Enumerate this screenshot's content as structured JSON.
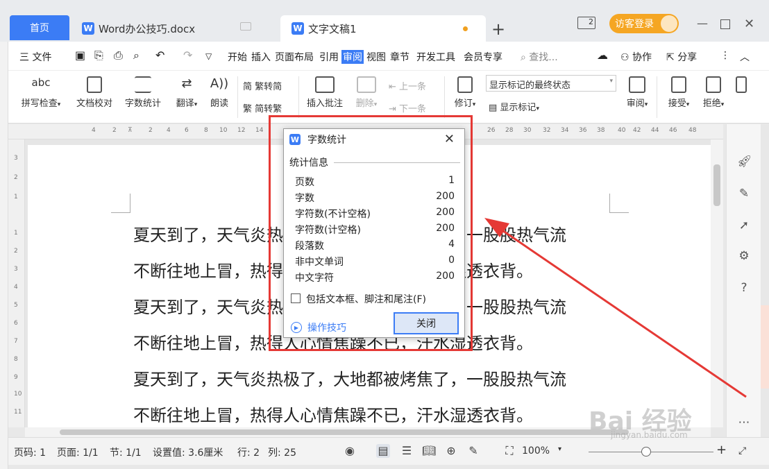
{
  "tabs": {
    "home": "首页",
    "doc1": "Word办公技巧.docx",
    "doc2": "文字文稿1",
    "doc_icon": "W"
  },
  "header": {
    "login": "访客登录"
  },
  "menu": {
    "file": "三 文件",
    "items": [
      "开始",
      "插入",
      "页面布局",
      "引用",
      "审阅",
      "视图",
      "章节",
      "开发工具",
      "会员专享"
    ],
    "search": "查找...",
    "collab": "协作",
    "share": "分享"
  },
  "ribbon": {
    "spell": "拼写检查",
    "proof": "文档校对",
    "wordcount": "字数统计",
    "translate": "翻译",
    "read": "朗读",
    "trad": "繁转简",
    "simp": "简转繁",
    "insert_comment": "插入批注",
    "delete": "删除",
    "prev": "上一条",
    "next": "下一条",
    "track": "修订",
    "show_state": "显示标记的最终状态",
    "show_marks": "显示标记",
    "review": "审阅",
    "accept": "接受",
    "reject": "拒绝"
  },
  "document": {
    "lines": [
      "夏天到了，天气炎热极了，大地都被烤焦了，一股股热气流",
      "不断往地上冒，热得人心情焦躁不已，汗水湿透衣背。",
      "夏天到了，天气炎热极了，大地都被烤焦了，一股股热气流",
      "不断往地上冒，热得人心情焦躁不已，汗水湿透衣背。",
      "夏天到了，天气炎热极了，大地都被烤焦了，一股股热气流",
      "不断往地上冒，热得人心情焦躁不已，汗水湿透衣背。"
    ]
  },
  "dialog": {
    "title": "字数统计",
    "section": "统计信息",
    "stats": [
      {
        "label": "页数",
        "value": "1"
      },
      {
        "label": "字数",
        "value": "200"
      },
      {
        "label": "字符数(不计空格)",
        "value": "200"
      },
      {
        "label": "字符数(计空格)",
        "value": "200"
      },
      {
        "label": "段落数",
        "value": "4"
      },
      {
        "label": "非中文单词",
        "value": "0"
      },
      {
        "label": "中文字符",
        "value": "200"
      }
    ],
    "checkbox_label": "包括文本框、脚注和尾注(F)",
    "tips": "操作技巧",
    "close": "关闭"
  },
  "status": {
    "page": "页码: 1",
    "pages": "页面: 1/1",
    "section": "节: 1/1",
    "setting": "设置值: 3.6厘米",
    "row": "行: 2",
    "col": "列: 25",
    "zoom": "100%"
  },
  "watermark": {
    "main": "Bai 经验",
    "sub": "jingyan.baidu.com"
  },
  "colors": {
    "accent": "#3b7cf5",
    "highlight": "#e53935",
    "login": "#f5a623"
  }
}
